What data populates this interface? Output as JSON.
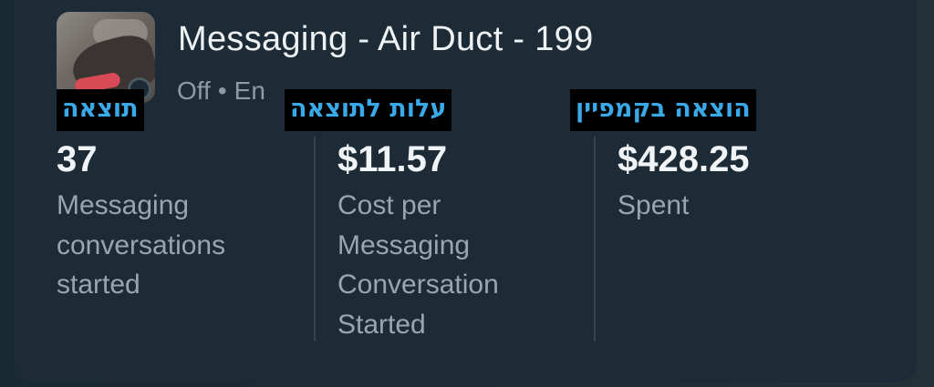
{
  "campaign": {
    "title": "Messaging - Air Duct - 199",
    "status": "Off",
    "separator": "•",
    "status_extra": "En"
  },
  "annotations": {
    "result": "תוצאה",
    "cost_per_result": "עלות לתוצאה",
    "campaign_spend": "הוצאה בקמפיין"
  },
  "metrics": [
    {
      "value": "37",
      "label": "Messaging conversations started"
    },
    {
      "value": "$11.57",
      "label": "Cost per Messaging Conversation Started"
    },
    {
      "value": "$428.25",
      "label": "Spent"
    }
  ],
  "icons": {
    "status": "status-indicator-icon"
  },
  "colors": {
    "card_background": "#1c2b35",
    "overlay_background": "#000000",
    "overlay_text": "#3aa9e8",
    "primary_text": "#eef2f4",
    "secondary_text": "#9aa5ad"
  }
}
